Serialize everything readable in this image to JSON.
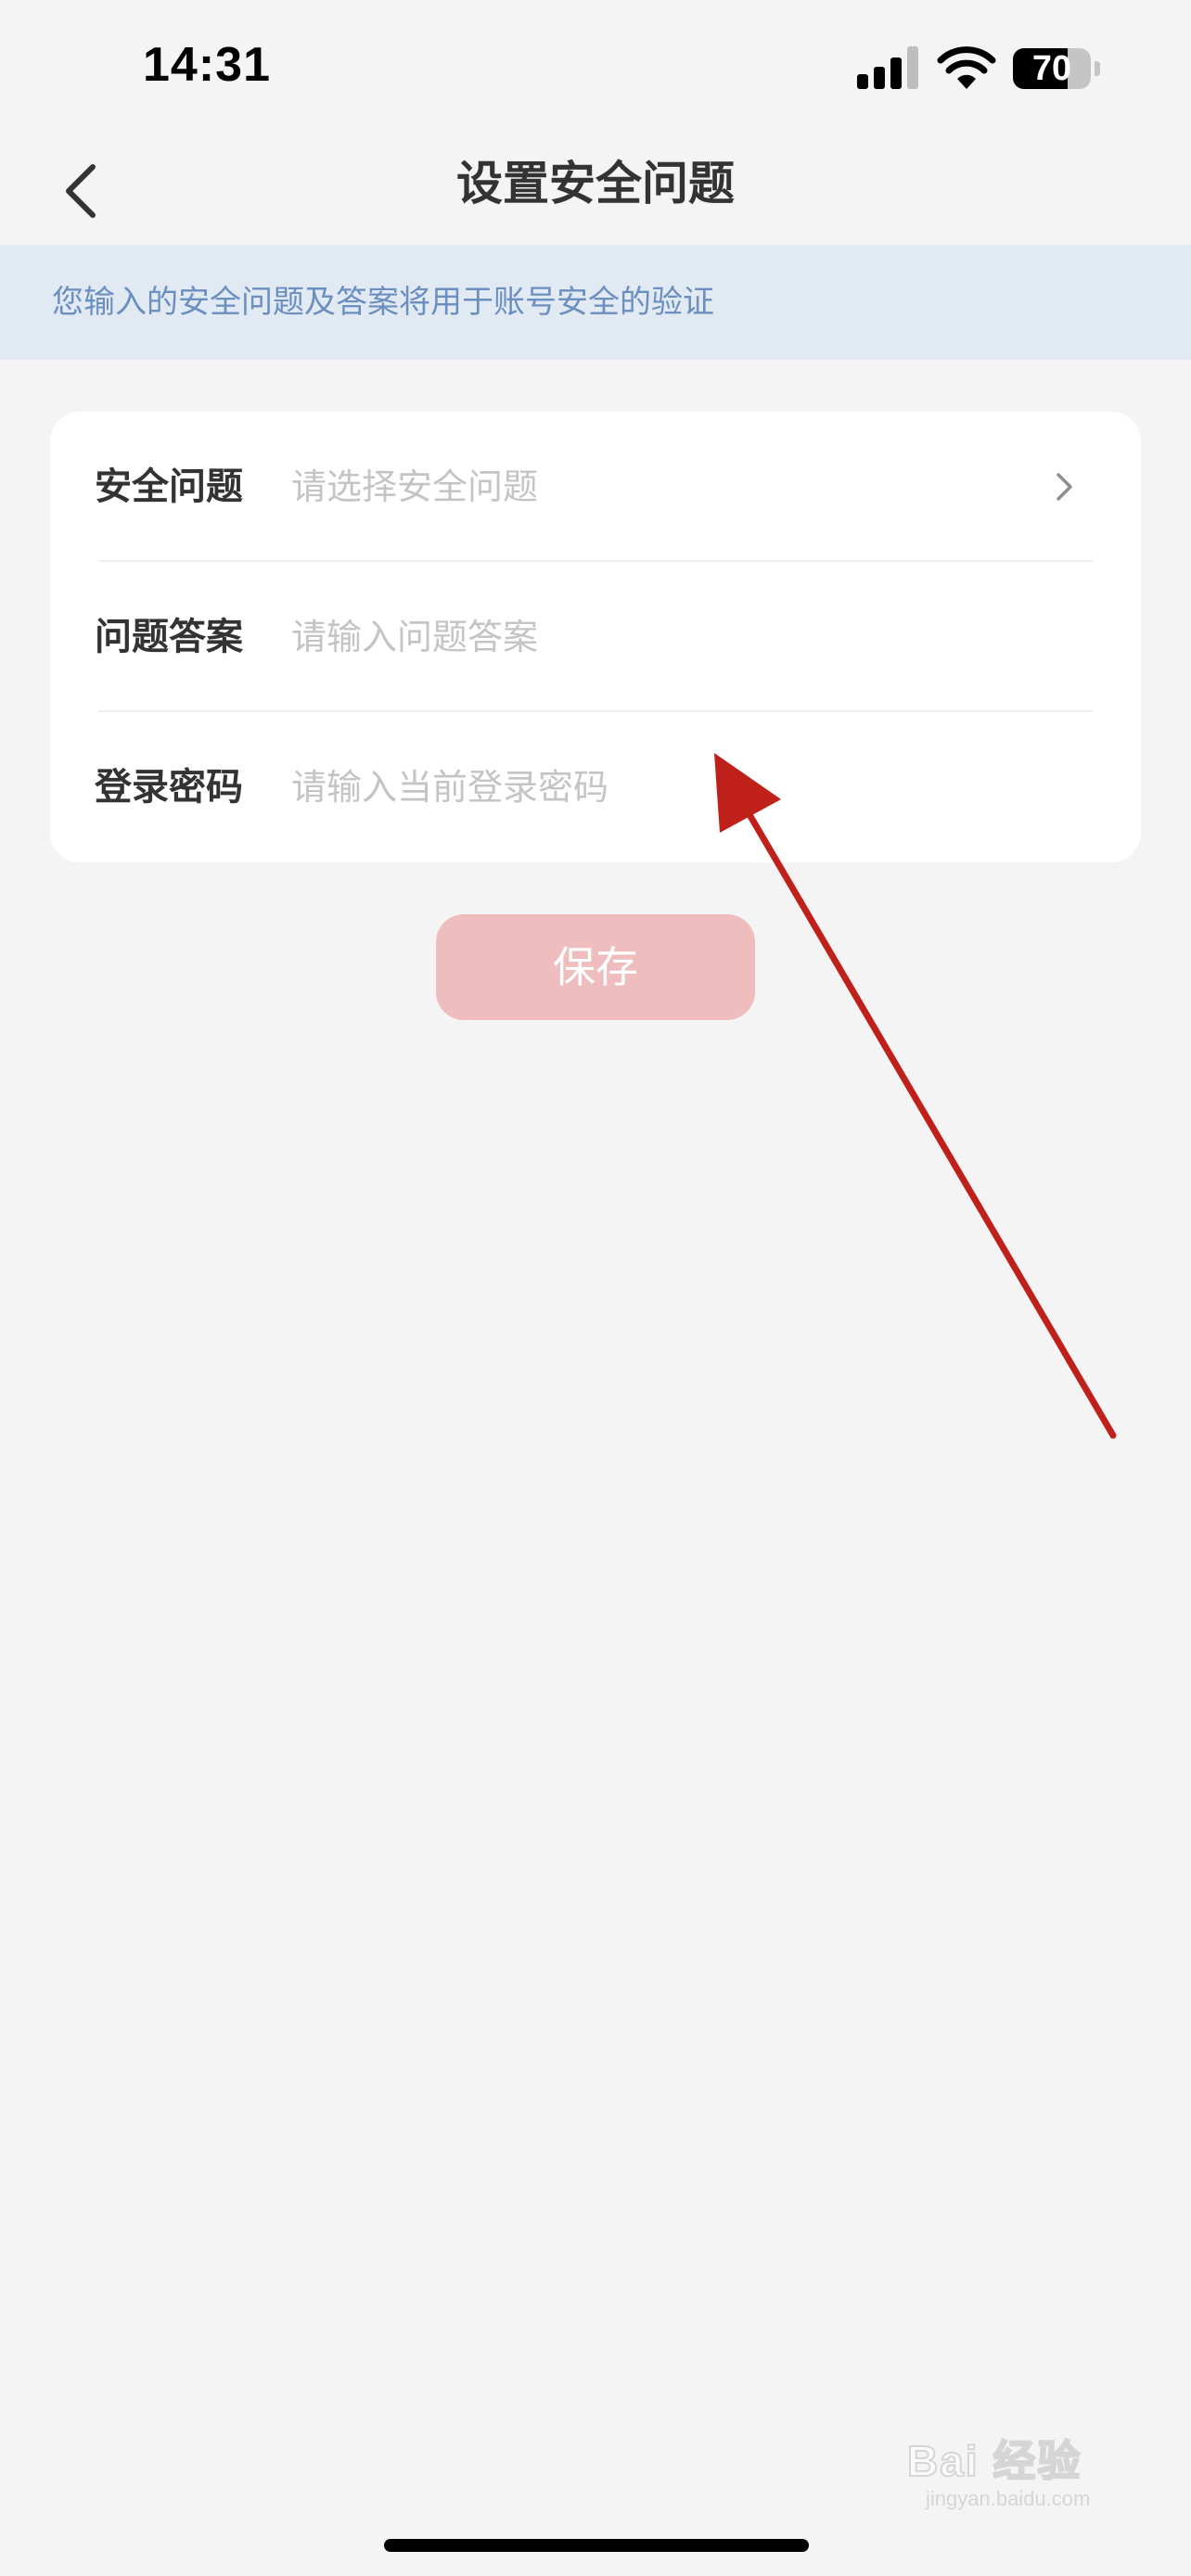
{
  "status_bar": {
    "time": "14:31",
    "battery_level": "70",
    "battery_fraction": 0.7
  },
  "nav": {
    "back_icon": "chevron-left-icon",
    "title": "设置安全问题"
  },
  "notice": {
    "text": "您输入的安全问题及答案将用于账号安全的验证"
  },
  "form": {
    "rows": [
      {
        "label": "安全问题",
        "placeholder": "请选择安全问题",
        "value": "",
        "trailing_icon": "chevron-right-icon"
      },
      {
        "label": "问题答案",
        "placeholder": "请输入问题答案",
        "value": ""
      },
      {
        "label": "登录密码",
        "placeholder": "请输入当前登录密码",
        "value": ""
      }
    ]
  },
  "save_button": {
    "label": "保存",
    "color": "#efbdbd"
  },
  "annotation": {
    "arrow_color": "#c0201a"
  },
  "watermark": {
    "main": "Bai 经验",
    "sub": "jingyan.baidu.com"
  },
  "colors": {
    "background": "#f4f4f4",
    "notice_bg": "#e1e9f3",
    "notice_text": "#6b8fbf",
    "card_bg": "#ffffff"
  }
}
